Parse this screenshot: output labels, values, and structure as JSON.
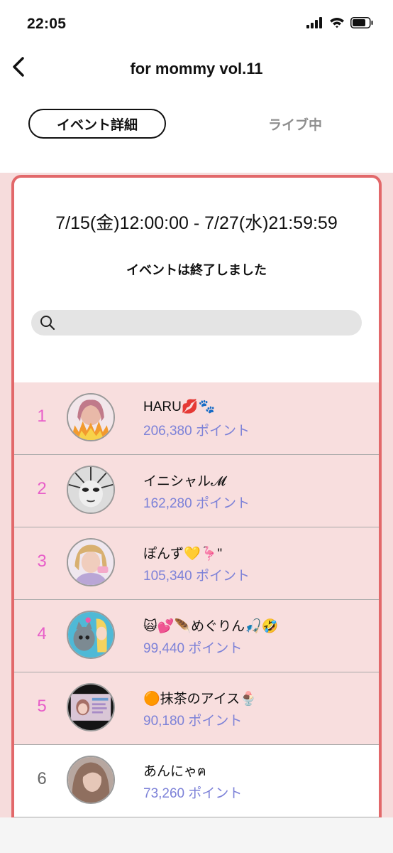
{
  "status": {
    "time": "22:05"
  },
  "nav": {
    "title": "for mommy vol.11"
  },
  "tabs": [
    {
      "label": "イベント詳細"
    },
    {
      "label": "ライブ中"
    }
  ],
  "event": {
    "period": "7/15(金)12:00:00 - 7/27(水)21:59:59",
    "status_text": "イベントは終了しました"
  },
  "search": {
    "placeholder": ""
  },
  "colors": {
    "accent": "#e2686a",
    "top_rank_bg": "#f8dede",
    "top_rank_number": "#e85fc9",
    "normal_rank_number": "#666666",
    "points": "#7d82d8"
  },
  "ranking": [
    {
      "rank": "1",
      "name": "HARU💋🐾",
      "points": "206,380 ポイント"
    },
    {
      "rank": "2",
      "name": "イニシャル𝓜",
      "points": "162,280 ポイント"
    },
    {
      "rank": "3",
      "name": "ぽんず💛🦩\"",
      "points": "105,340 ポイント"
    },
    {
      "rank": "4",
      "name": "🙀💕🪶めぐりん🎣🤣",
      "points": "99,440 ポイント"
    },
    {
      "rank": "5",
      "name": "🟠抹茶のアイス🍨",
      "points": "90,180 ポイント"
    },
    {
      "rank": "6",
      "name": "あんにゃฅ",
      "points": "73,260 ポイント"
    }
  ]
}
